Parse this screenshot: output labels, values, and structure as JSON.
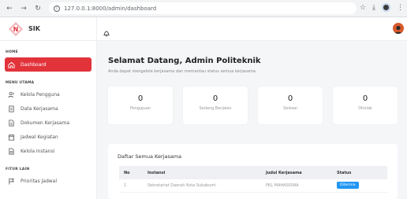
{
  "browser": {
    "url": "127.0.0.1:8000/admin/dashboard",
    "back_icon": "back-arrow-icon",
    "forward_icon": "forward-arrow-icon",
    "reload_icon": "reload-icon"
  },
  "brand": {
    "name": "SIK",
    "accent": "#e2333b"
  },
  "sidebar": {
    "sections": [
      {
        "label": "HOME",
        "items": [
          {
            "label": "Dashboard",
            "icon": "home-icon",
            "active": true
          }
        ]
      },
      {
        "label": "MENU UTAMA",
        "items": [
          {
            "label": "Kelola Pengguna",
            "icon": "users-icon"
          },
          {
            "label": "Data Kerjasama",
            "icon": "document-icon"
          },
          {
            "label": "Dokumen Kerjasama",
            "icon": "file-icon"
          },
          {
            "label": "Jadwal Kegiatan",
            "icon": "calendar-icon"
          },
          {
            "label": "Kelola Instansi",
            "icon": "building-icon"
          }
        ]
      },
      {
        "label": "FITUR LAIN",
        "items": [
          {
            "label": "Prioritas Jadwal",
            "icon": "flag-icon"
          }
        ]
      }
    ]
  },
  "main": {
    "welcome_title": "Selamat Datang, Admin Politeknik",
    "welcome_subtitle": "Anda dapat mengelola kerjasama dan memantau status semua kerjasama.",
    "stats": [
      {
        "value": "0",
        "label": "Pengajuan"
      },
      {
        "value": "0",
        "label": "Sedang Berjalan"
      },
      {
        "value": "0",
        "label": "Selesai"
      },
      {
        "value": "0",
        "label": "Ditolak"
      }
    ],
    "table": {
      "title": "Daftar Semua Kerjasama",
      "columns": [
        "No",
        "Instansi",
        "Judul Kerjasama",
        "Status"
      ],
      "rows": [
        {
          "no": "1",
          "instansi": "Sekretariat Daerah Kota Sukabumi",
          "judul": "PKL MAHASISWA",
          "status": "Diterima"
        }
      ],
      "status_color": "#2196f3"
    }
  }
}
